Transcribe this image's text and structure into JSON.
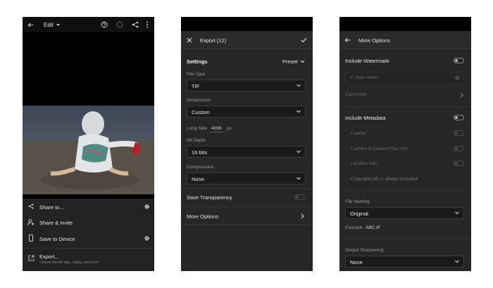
{
  "panel1": {
    "edit_label": "Edit",
    "menu": [
      {
        "label": "Share to..."
      },
      {
        "label": "Share & Invite"
      },
      {
        "label": "Save to Device"
      }
    ],
    "export_title": "Export...",
    "export_subtitle": "Choose the file type, sizing, and more"
  },
  "panel2": {
    "title": "Export (12)",
    "settings_label": "Settings",
    "preset_label": "Preset",
    "file_type_label": "File Type",
    "file_type_value": "TIF",
    "dimensions_label": "Dimensions",
    "dimensions_value": "Custom",
    "long_side_label": "Long Side",
    "long_side_value": "4096",
    "long_side_unit": "px",
    "bit_depth_label": "Bit Depth",
    "bit_depth_value": "16 bits",
    "compression_label": "Compression",
    "compression_value": "None",
    "save_transparency_label": "Save Transparency",
    "more_options_label": "More Options"
  },
  "panel3": {
    "title": "More Options",
    "include_watermark_label": "Include Watermark",
    "watermark_text": "© Josh Haftel",
    "customize_label": "Customize",
    "include_metadata_label": "Include Metadata",
    "caption_label": "Caption",
    "camera_raw_label": "Camera & Camera Raw Info",
    "location_label": "Location Info",
    "copyright_note": "Copyright info is always included",
    "file_naming_label": "File Naming",
    "file_naming_value": "Original",
    "example_label": "Example",
    "example_value": "ABC.tif",
    "output_sharpening_label": "Output Sharpening",
    "output_sharpening_value": "None"
  },
  "colors": {
    "background": "#262626",
    "field": "#1a1a1a",
    "text": "#e6e6e6",
    "muted": "#9a9a9a"
  }
}
